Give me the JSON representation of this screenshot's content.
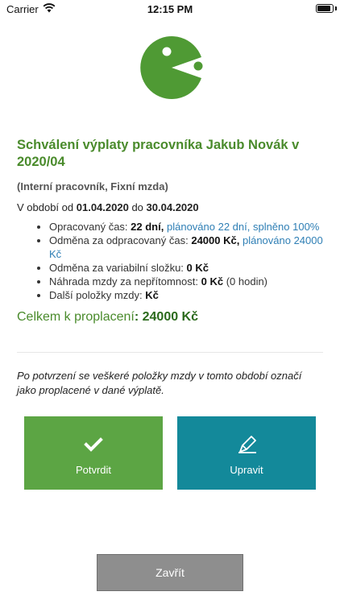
{
  "status_bar": {
    "carrier": "Carrier",
    "time": "12:15 PM"
  },
  "icons": {
    "logo": "pacman-logo-icon",
    "confirm": "checkmark-icon",
    "edit": "pencil-icon",
    "wifi": "wifi-icon",
    "battery": "battery-icon"
  },
  "colors": {
    "title_green": "#4a8b2c",
    "confirm_green": "#5ca544",
    "edit_teal": "#13899a",
    "close_gray": "#8e8e8e",
    "link_blue": "#2f7fb5"
  },
  "header": {
    "title": "Schválení výplaty pracovníka Jakub Novák v 2020/04",
    "subtitle": "(Interní pracovník, Fixní mzda)"
  },
  "period": {
    "prefix": "V období od",
    "from": "01.04.2020",
    "middle": "do",
    "to": "30.04.2020"
  },
  "details": {
    "worked_time": {
      "label": "Opracovaný čas:",
      "value": "22 dní,",
      "note": "plánováno 22 dní, splněno 100%"
    },
    "worked_pay": {
      "label": "Odměna za odpracovaný čas:",
      "value": "24000 Kč,",
      "note": "plánováno 24000 Kč"
    },
    "variable_pay": {
      "label": "Odměna za variabilní složku:",
      "value": "0 Kč"
    },
    "absence_pay": {
      "label": "Náhrada mzdy za nepřítomnost:",
      "value": "0 Kč",
      "note": "(0 hodin)"
    },
    "other_items": {
      "label": "Další položky mzdy:",
      "value": "Kč"
    }
  },
  "total": {
    "label": "Celkem k proplacení",
    "value": ": 24000 Kč"
  },
  "note": "Po potvrzení se veškeré položky mzdy v tomto období označí jako proplacené v dané výplatě.",
  "buttons": {
    "confirm": "Potvrdit",
    "edit": "Upravit",
    "close": "Zavřít"
  }
}
